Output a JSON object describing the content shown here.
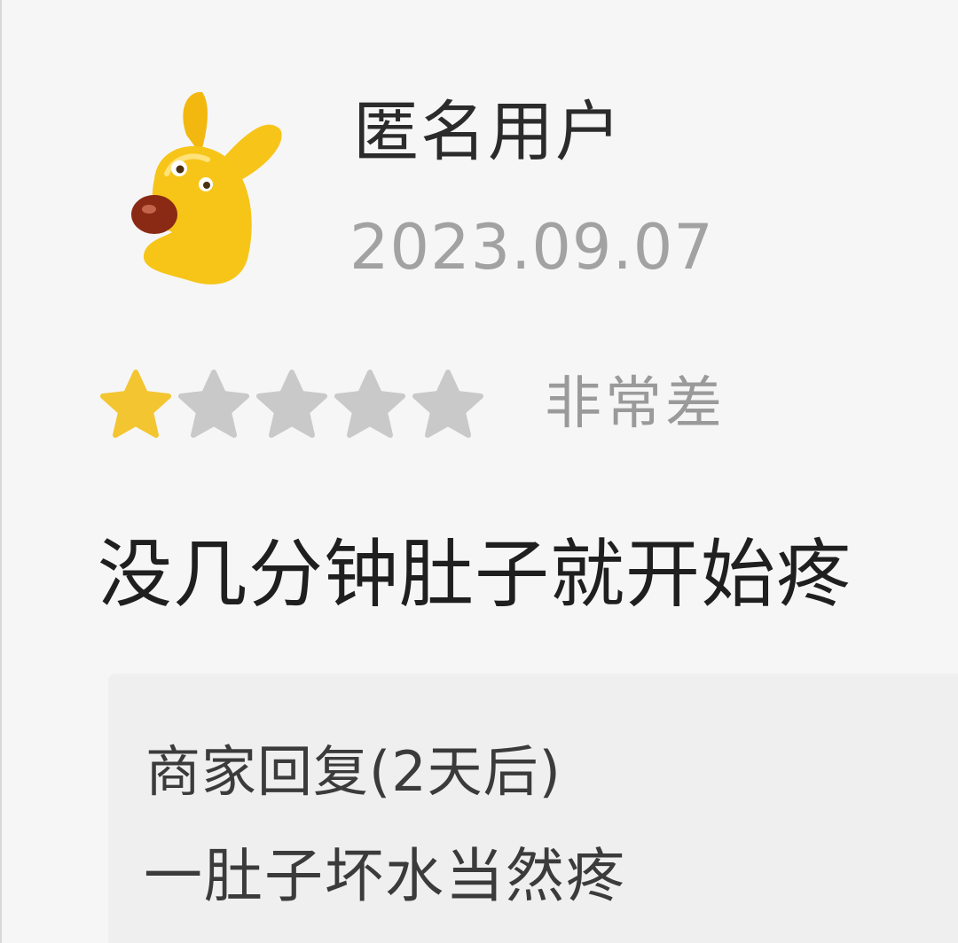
{
  "review": {
    "user_name": "匿名用户",
    "date": "2023.09.07",
    "avatar_icon": "yellow-dog-avatar-icon",
    "rating": 1,
    "rating_max": 5,
    "rating_label": "非常差",
    "content": "没几分钟肚子就开始疼"
  },
  "merchant_reply": {
    "title": "商家回复(2天后)",
    "content": "一肚子坏水当然疼"
  },
  "colors": {
    "star_filled": "#f3c531",
    "star_empty": "#c9c9c9",
    "avatar_yellow": "#f6c518",
    "avatar_nose": "#8a2a14"
  }
}
